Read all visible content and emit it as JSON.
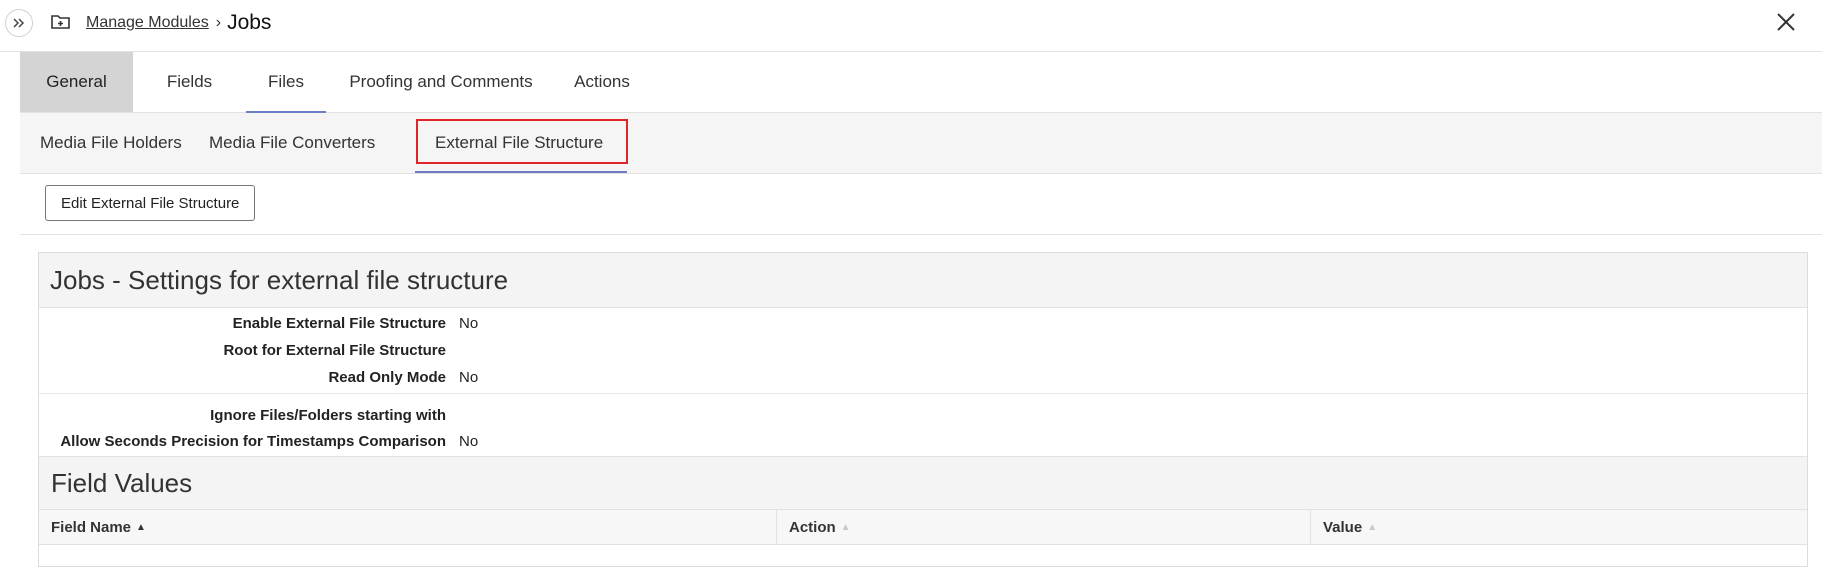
{
  "breadcrumb": {
    "parent": "Manage Modules",
    "separator": "›",
    "current": "Jobs"
  },
  "main_tabs": [
    {
      "label": "General"
    },
    {
      "label": "Fields"
    },
    {
      "label": "Files"
    },
    {
      "label": "Proofing and Comments"
    },
    {
      "label": "Actions"
    }
  ],
  "sub_tabs": [
    {
      "label": "Media File Holders"
    },
    {
      "label": "Media File Converters"
    },
    {
      "label": "External File Structure"
    }
  ],
  "toolbar": {
    "edit_label": "Edit External File Structure"
  },
  "settings": {
    "title": "Jobs - Settings for external file structure",
    "group1": [
      {
        "label": "Enable External File Structure",
        "value": "No"
      },
      {
        "label": "Root for External File Structure",
        "value": ""
      },
      {
        "label": "Read Only Mode",
        "value": "No"
      }
    ],
    "group2": [
      {
        "label": "Ignore Files/Folders starting with",
        "value": ""
      },
      {
        "label": "Allow Seconds Precision for Timestamps Comparison",
        "value": "No"
      }
    ]
  },
  "field_values": {
    "title": "Field Values",
    "columns": [
      {
        "label": "Field Name",
        "sort": "▲"
      },
      {
        "label": "Action",
        "sort": "▲"
      },
      {
        "label": "Value",
        "sort": "▲"
      }
    ]
  },
  "colors": {
    "highlight_border": "#e0252a",
    "tab_underline": "#6d7cc4",
    "selected_tab_bg": "#d4d4d4"
  }
}
